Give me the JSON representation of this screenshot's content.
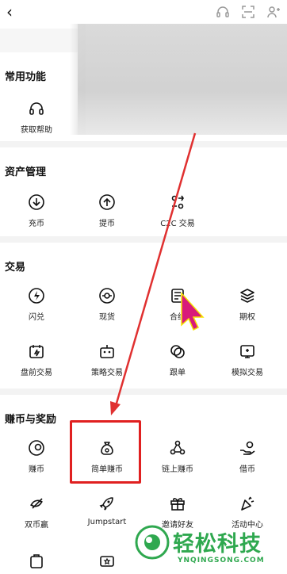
{
  "sections": [
    {
      "title": "常用功能",
      "items": [
        {
          "label": "获取帮助",
          "icon": "headset-icon"
        }
      ]
    },
    {
      "title": "资产管理",
      "items": [
        {
          "label": "充币",
          "icon": "deposit-icon"
        },
        {
          "label": "提币",
          "icon": "withdraw-icon"
        },
        {
          "label": "C2C 交易",
          "icon": "c2c-icon"
        }
      ]
    },
    {
      "title": "交易",
      "items": [
        {
          "label": "闪兑",
          "icon": "flash-icon"
        },
        {
          "label": "现货",
          "icon": "spot-icon"
        },
        {
          "label": "合约",
          "icon": "contract-icon"
        },
        {
          "label": "期权",
          "icon": "layers-icon"
        },
        {
          "label": "盘前交易",
          "icon": "premarket-icon"
        },
        {
          "label": "策略交易",
          "icon": "bot-icon"
        },
        {
          "label": "跟单",
          "icon": "copy-trade-icon"
        },
        {
          "label": "模拟交易",
          "icon": "demo-trade-icon"
        }
      ]
    },
    {
      "title": "赚币与奖励",
      "items": [
        {
          "label": "赚币",
          "icon": "earn-icon"
        },
        {
          "label": "简单赚币",
          "icon": "money-bag-icon"
        },
        {
          "label": "链上赚币",
          "icon": "chain-icon"
        },
        {
          "label": "借币",
          "icon": "loan-icon"
        },
        {
          "label": "双币赢",
          "icon": "dual-icon"
        },
        {
          "label": "Jumpstart",
          "icon": "rocket-icon"
        },
        {
          "label": "邀请好友",
          "icon": "gift-icon"
        },
        {
          "label": "活动中心",
          "icon": "party-icon"
        }
      ]
    }
  ],
  "watermark": {
    "text": "轻松科技",
    "sub": "YNQINGSONG.COM"
  },
  "colors": {
    "arrow": "#e03030",
    "highlight": "#e02020",
    "watermark": "#2fa84f",
    "cursor": "#d81b7a"
  }
}
